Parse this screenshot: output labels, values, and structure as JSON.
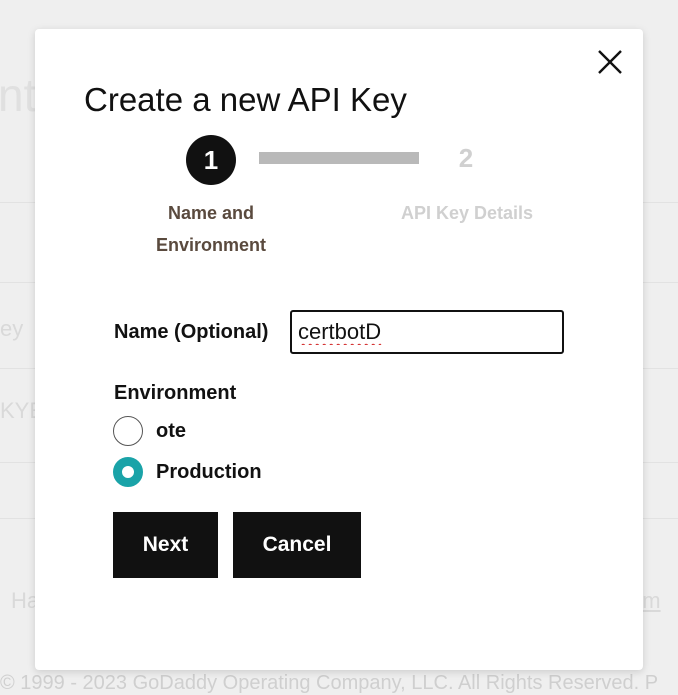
{
  "background": {
    "title_fragment": "nt",
    "row1_fragment": "ey",
    "row2_fragment": "KYE",
    "help_fragment": "Ha",
    "link_fragment": "om",
    "footer": "© 1999 - 2023 GoDaddy Operating Company, LLC. All Rights Reserved. P"
  },
  "modal": {
    "title": "Create a new API Key",
    "close_icon": "close-icon",
    "steps": [
      {
        "number": "1",
        "label": "Name and Environment",
        "active": true
      },
      {
        "number": "2",
        "label": "API Key Details",
        "active": false
      }
    ],
    "name_field": {
      "label": "Name (Optional)",
      "value": "certbotD"
    },
    "environment": {
      "label": "Environment",
      "options": [
        {
          "label": "ote",
          "selected": false
        },
        {
          "label": "Production",
          "selected": true
        }
      ]
    },
    "buttons": {
      "next": "Next",
      "cancel": "Cancel"
    }
  },
  "colors": {
    "primary": "#111111",
    "radio_selected": "#1aa3a8",
    "step_inactive": "#d0d0d0",
    "step_label_active": "#5a4a3e"
  }
}
